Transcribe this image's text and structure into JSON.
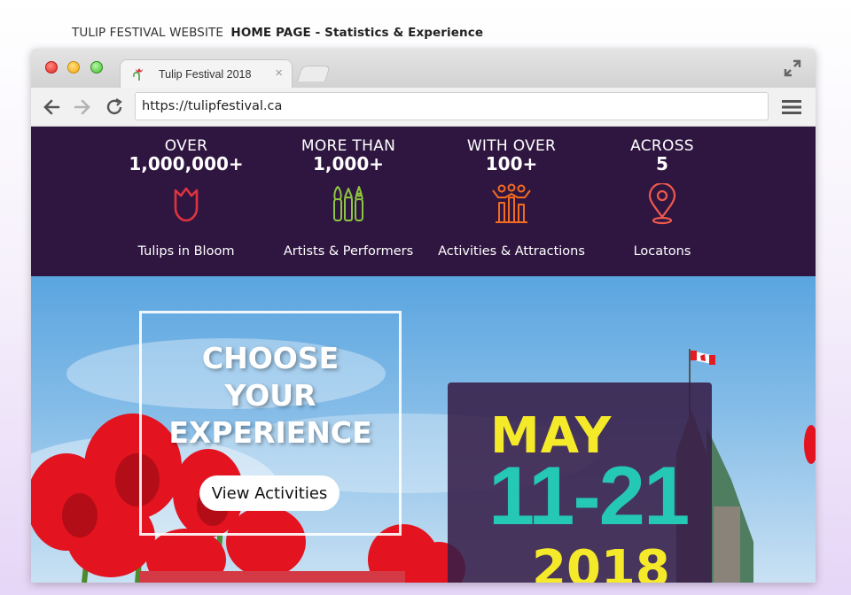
{
  "caption": {
    "prefix": "TULIP FESTIVAL WEBSITE",
    "title": "HOME PAGE - Statistics & Experience"
  },
  "browser": {
    "tab_title": "Tulip Festival 2018",
    "tab_close": "×",
    "url": "https://tulipfestival.ca"
  },
  "stats": [
    {
      "prefix": "OVER",
      "number": "1,000,000+",
      "label": "Tulips in Bloom",
      "icon": "tulip-icon"
    },
    {
      "prefix": "MORE THAN",
      "number": "1,000+",
      "label": "Artists & Performers",
      "icon": "art-supplies-icon"
    },
    {
      "prefix": "WITH OVER",
      "number": "100+",
      "label": "Activities & Attractions",
      "icon": "people-chart-icon"
    },
    {
      "prefix": "ACROSS",
      "number": "5",
      "label": "Locatons",
      "icon": "location-pin-icon"
    }
  ],
  "hero": {
    "title": "CHOOSE\nYOUR\nEXPERIENCE",
    "button_label": "View Activities",
    "date_month": "MAY",
    "date_range": "11-21",
    "date_year": "2018"
  },
  "colors": {
    "stats_bg": "#2f1640",
    "tulip_icon": "#e0333e",
    "artists_icon": "#8dc63f",
    "activities_icon": "#f26b21",
    "location_icon": "#f05a4c",
    "date_yellow": "#f5ea2a",
    "date_teal": "#25c7b5"
  }
}
